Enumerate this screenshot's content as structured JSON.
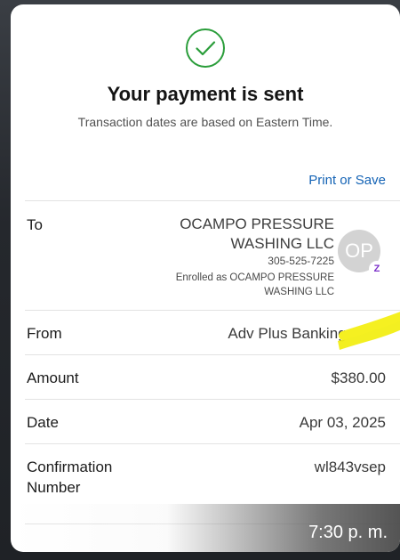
{
  "header": {
    "title": "Your payment is sent",
    "subtitle": "Transaction dates are based on Eastern Time."
  },
  "actions": {
    "print_or_save": "Print or Save"
  },
  "recipient": {
    "label": "To",
    "name": "OCAMPO PRESSURE WASHING LLC",
    "phone": "305-525-7225",
    "enrolled_as": "Enrolled as OCAMPO PRESSURE WASHING LLC",
    "avatar_initials": "OP",
    "badge_icon": "zelle-icon",
    "badge_char": "Z"
  },
  "from": {
    "label": "From",
    "value": "Adv Plus Banking - "
  },
  "amount": {
    "label": "Amount",
    "value": "$380.00"
  },
  "date": {
    "label": "Date",
    "value": "Apr 03, 2025"
  },
  "confirmation": {
    "label": "Confirmation Number",
    "value": "wl843vsep"
  },
  "overlay": {
    "time": "7:30 p. m."
  },
  "colors": {
    "accent": "#1463b5",
    "success": "#2a9d3a",
    "highlight": "#f2ee15",
    "zelle": "#7b2fc9"
  }
}
